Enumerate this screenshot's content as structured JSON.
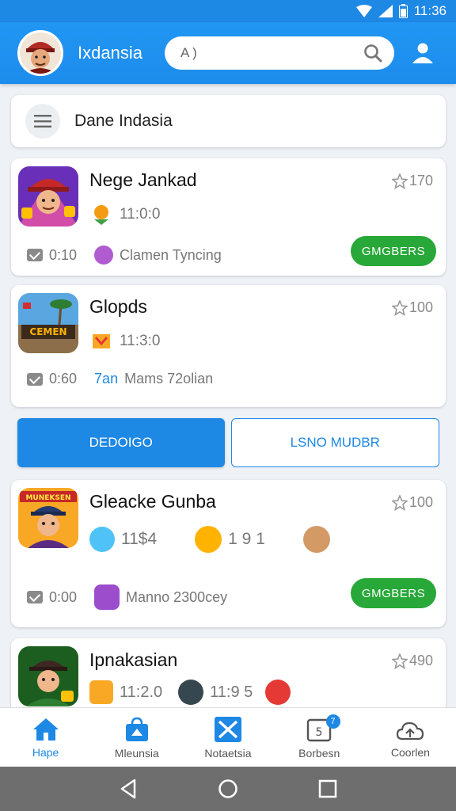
{
  "status_bar": {
    "time": "11:36"
  },
  "app_bar": {
    "title": "Ixdansia",
    "search_value": "A )"
  },
  "filter": {
    "label": "Dane Indasia"
  },
  "games": [
    {
      "name": "Nege Jankad",
      "count": "170",
      "stat": "11:0:0",
      "msg_count": "0:10",
      "sub_text": "Clamen Tyncing",
      "action": "GMGBERS"
    },
    {
      "name": "Glopds",
      "count": "100",
      "stat": "11:3:0",
      "msg_count": "0:60",
      "sub_prefix": "7an",
      "sub_text": "Mams 72olian",
      "thumb_text": "CEMEN"
    },
    {
      "name": "Gleacke Gunba",
      "count": "100",
      "stat1": "11$4",
      "stat2": "1 9 1",
      "msg_count": "0:00",
      "sub_text": "Manno 2300cey",
      "action": "GMGBERS",
      "thumb_text": "MUNEKSEN"
    },
    {
      "name": "Ipnakasian",
      "count": "490",
      "stat1": "11:2.0",
      "stat2": "11:9 5"
    }
  ],
  "actions": {
    "primary": "DEDOIGO",
    "secondary": "LSNO MUDBR"
  },
  "nav": [
    {
      "label": "Hape",
      "icon": "home-icon"
    },
    {
      "label": "Mleunsia",
      "icon": "bag-icon"
    },
    {
      "label": "Notaetsia",
      "icon": "notification-icon"
    },
    {
      "label": "Borbesn",
      "icon": "inbox-icon",
      "badge": "7"
    },
    {
      "label": "Coorlen",
      "icon": "cloud-icon"
    }
  ],
  "colors": {
    "primary": "#1e88e5",
    "accent_green": "#27a838"
  }
}
